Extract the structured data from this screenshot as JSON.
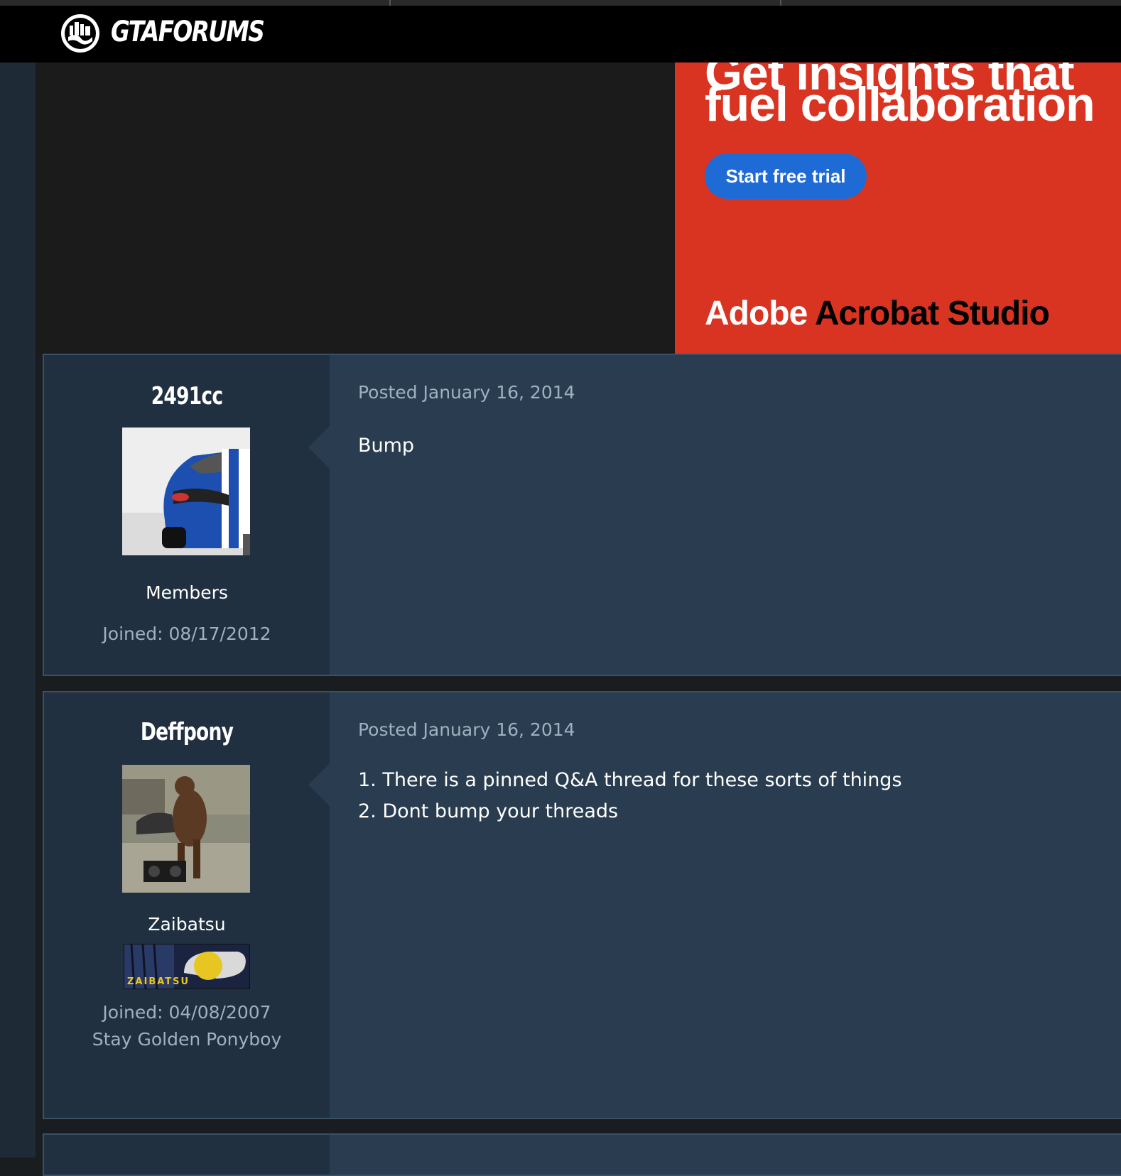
{
  "site": {
    "name": "GTAFORUMS"
  },
  "ad": {
    "headline_partial": "Get insights that",
    "headline": "fuel collaboration",
    "cta": "Start free trial",
    "brand_a": "Adobe",
    "brand_b": "Acrobat Studio",
    "colors": {
      "background": "#d93422",
      "button": "#1f6bd6"
    }
  },
  "posts": [
    {
      "username": "2491cc",
      "group": "Members",
      "joined": "Joined: 08/17/2012",
      "posted": "Posted January 16, 2014",
      "body": [
        "Bump"
      ]
    },
    {
      "username": "Deffpony",
      "group": "Zaibatsu",
      "badge": "ZAIBATSU",
      "joined": "Joined: 04/08/2007",
      "signature": "Stay Golden Ponyboy",
      "posted": "Posted January 16, 2014",
      "body": [
        "1. There is a pinned Q&A thread for these sorts of things",
        "2. Dont bump your threads"
      ]
    }
  ]
}
